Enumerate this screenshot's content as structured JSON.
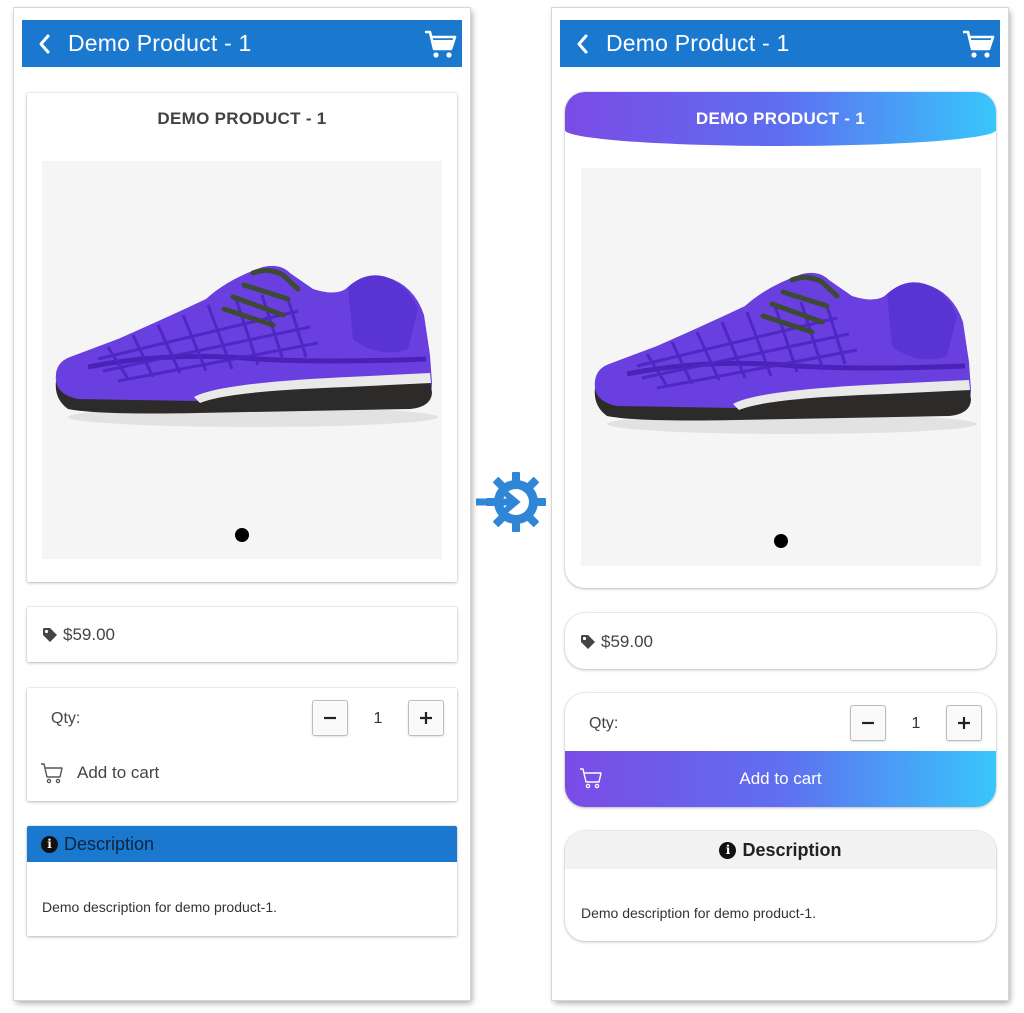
{
  "screens": [
    {
      "appbar": {
        "title": "Demo Product - 1",
        "back_icon": "chevron-left-icon",
        "cart_icon": "shopping-cart-icon"
      },
      "product_title": "DEMO PRODUCT - 1",
      "price": "$59.00",
      "qty_label": "Qty:",
      "qty_value": "1",
      "add_to_cart": "Add to cart",
      "description_header": "Description",
      "description_text": "Demo description for demo product-1.",
      "style": "flat"
    },
    {
      "appbar": {
        "title": "Demo Product - 1",
        "back_icon": "chevron-left-icon",
        "cart_icon": "shopping-cart-icon"
      },
      "product_title": "DEMO PRODUCT - 1",
      "price": "$59.00",
      "qty_label": "Qty:",
      "qty_value": "1",
      "add_to_cart": "Add to cart",
      "description_header": "Description",
      "description_text": "Demo description for demo product-1.",
      "style": "rounded-gradient"
    }
  ],
  "colors": {
    "appbar": "#1a79cf",
    "gradient_start": "#7b4be6",
    "gradient_end": "#38c6fb",
    "transform_icon": "#2f86d6"
  }
}
